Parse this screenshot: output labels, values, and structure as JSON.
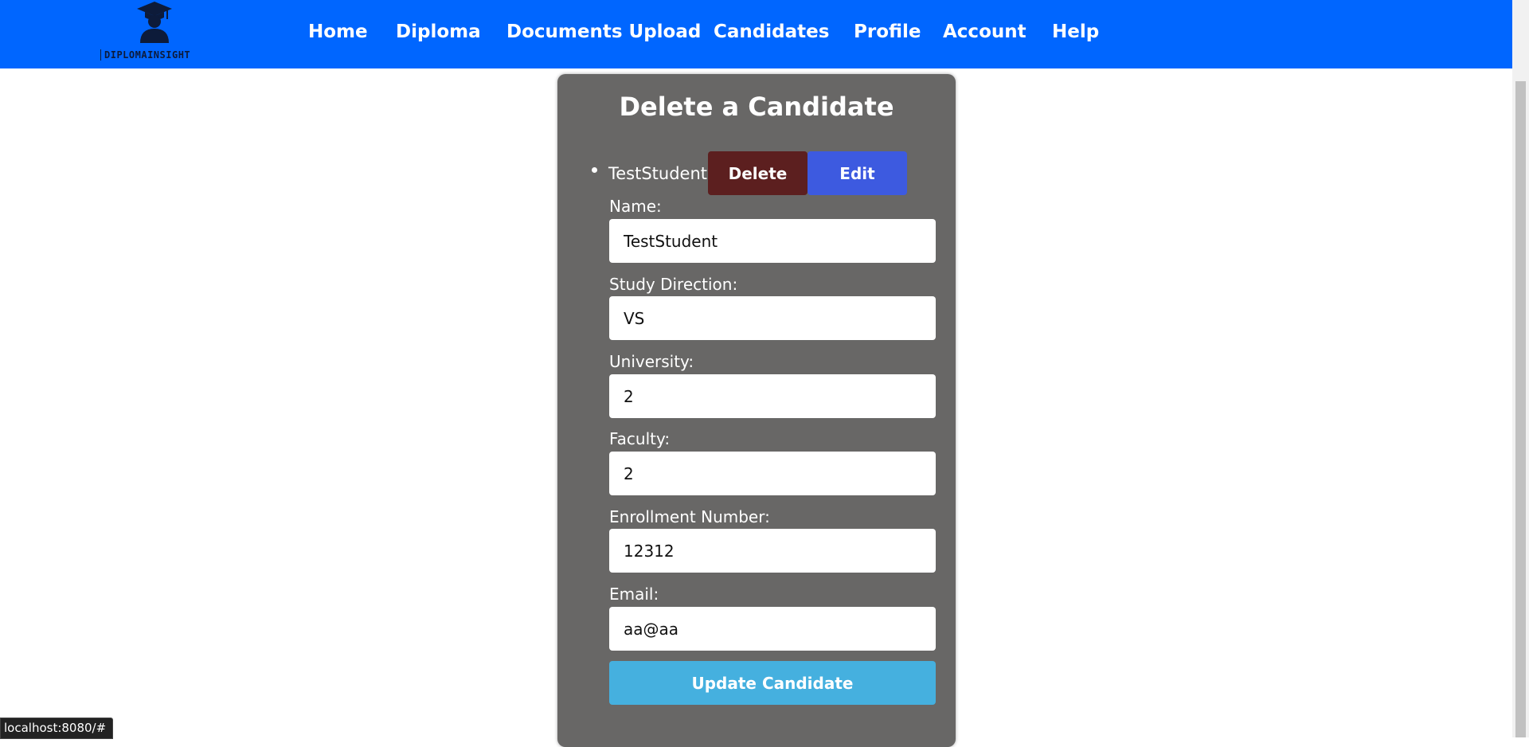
{
  "brand": {
    "logo_text": "DIPLOMAINSIGHT",
    "logo_icon": "graduate-icon"
  },
  "nav": {
    "items": [
      {
        "label": "Home"
      },
      {
        "label": "Diploma"
      },
      {
        "label": "Documents Upload"
      },
      {
        "label": "Candidates"
      },
      {
        "label": "Profile"
      },
      {
        "label": "Account"
      },
      {
        "label": "Help"
      }
    ]
  },
  "card": {
    "title": "Delete a Candidate",
    "candidate_name": "TestStudent",
    "delete_label": "Delete",
    "edit_label": "Edit",
    "fields": [
      {
        "label": "Name:",
        "value": "TestStudent"
      },
      {
        "label": "Study Direction:",
        "value": "VS"
      },
      {
        "label": "University:",
        "value": "2"
      },
      {
        "label": "Faculty:",
        "value": "2"
      },
      {
        "label": "Enrollment Number:",
        "value": "12312"
      },
      {
        "label": "Email:",
        "value": "aa@aa"
      }
    ],
    "update_label": "Update Candidate"
  },
  "status_bar": {
    "url": "localhost:8080/#"
  },
  "colors": {
    "navbar": "#0066ff",
    "card": "#686766",
    "delete": "#5c1f1f",
    "edit": "#3d5ae0",
    "update": "#45b0df"
  }
}
